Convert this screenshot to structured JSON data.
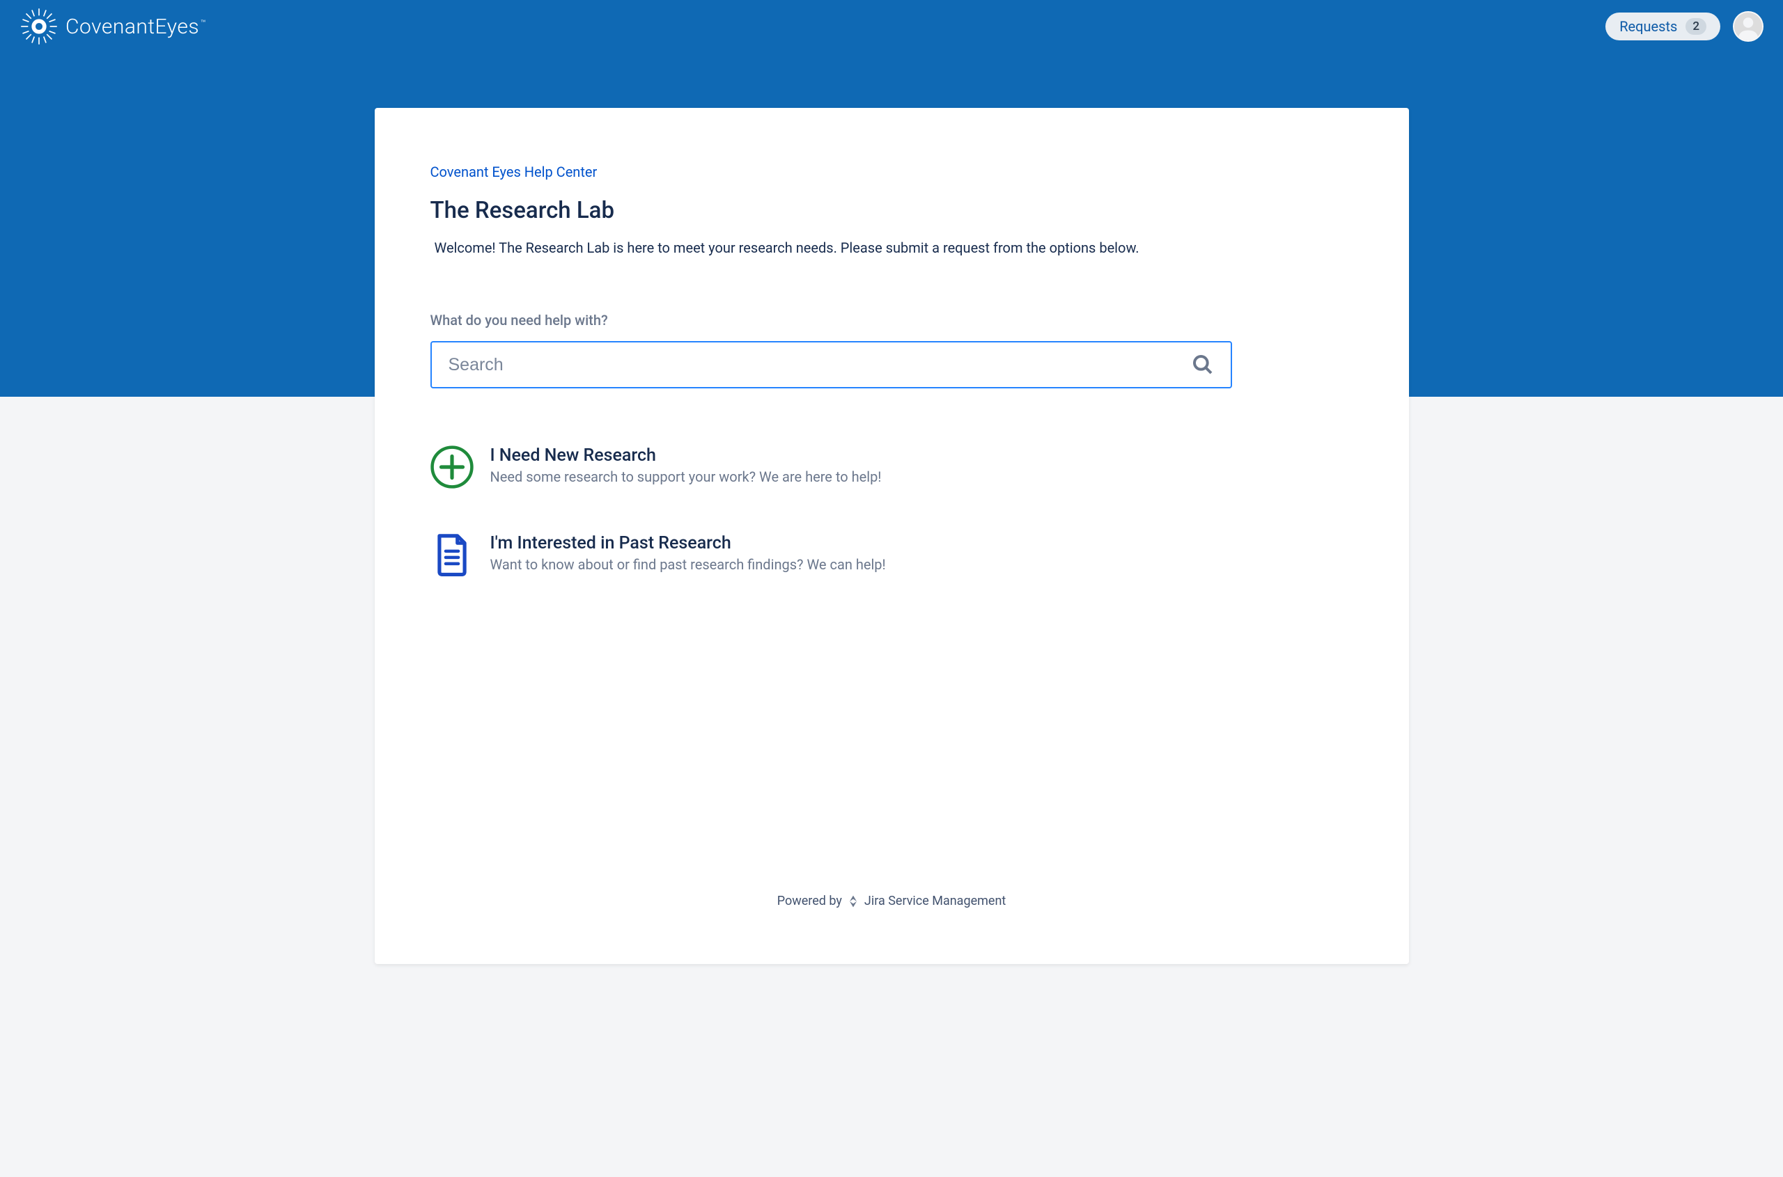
{
  "header": {
    "logo_text": "CovenantEyes",
    "requests_label": "Requests",
    "requests_count": "2"
  },
  "main": {
    "breadcrumb": "Covenant Eyes Help Center",
    "title": "The Research Lab",
    "welcome": "Welcome! The Research Lab is here to meet your research needs. Please submit a request from the options below.",
    "search_label": "What do you need help with?",
    "search_placeholder": "Search",
    "options": [
      {
        "title": "I Need New Research",
        "desc": "Need some research to support your work? We are here to help!"
      },
      {
        "title": "I'm Interested in Past Research",
        "desc": "Want to know about or find past research findings? We can help!"
      }
    ]
  },
  "footer": {
    "powered_by_prefix": "Powered by ",
    "product": "Jira Service Management"
  }
}
